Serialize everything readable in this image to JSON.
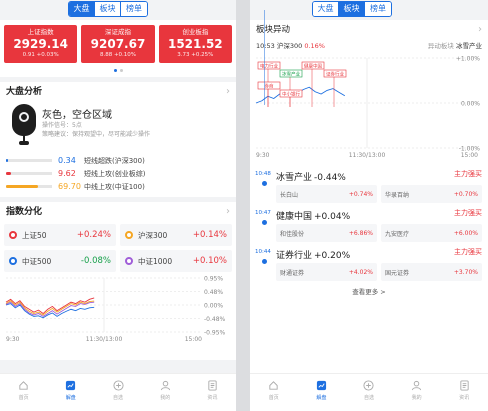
{
  "left": {
    "segment": {
      "tabs": [
        "大盘",
        "板块",
        "榜单"
      ],
      "active": 0
    },
    "indices": [
      {
        "name": "上证指数",
        "value": "2929.14",
        "change": "0.91 +0.03%"
      },
      {
        "name": "深证成指",
        "value": "9207.67",
        "change": "8.88 +0.10%"
      },
      {
        "name": "创业板指",
        "value": "1521.52",
        "change": "3.73 +0.25%"
      }
    ],
    "analysis": {
      "title": "大盘分析",
      "status": "灰色，空仓区域",
      "signal": "操作信号：5点",
      "advice": "策略建议：保持观望中，尽可能减少操作",
      "lines": [
        {
          "value": "0.34",
          "label": "短线超跌(沪深300)",
          "fill": 0.05,
          "color": "#1d6fe0"
        },
        {
          "value": "9.62",
          "label": "短线上攻(创业板综)",
          "fill": 0.1,
          "color": "#e8363d"
        },
        {
          "value": "69.70",
          "label": "中线上攻(中证100)",
          "fill": 0.7,
          "color": "#f5a623"
        }
      ]
    },
    "differentiation": {
      "title": "指数分化",
      "items": [
        {
          "name": "上证50",
          "pct": "+0.24%",
          "color": "#e8363d",
          "dir": "up"
        },
        {
          "name": "沪深300",
          "pct": "+0.14%",
          "color": "#f5a623",
          "dir": "up"
        },
        {
          "name": "中证500",
          "pct": "-0.08%",
          "color": "#1d6fe0",
          "dir": "down"
        },
        {
          "name": "中证1000",
          "pct": "+0.10%",
          "color": "#a05ed8",
          "dir": "up"
        }
      ]
    },
    "chart_data": {
      "type": "line",
      "x_ticks": [
        "9:30",
        "11:30/13:00",
        "15:00"
      ],
      "y_ticks": [
        "0.95%",
        "0.48%",
        "0.00%",
        "-0.48%",
        "-0.95%"
      ],
      "ylim": [
        -0.95,
        0.95
      ],
      "series": [
        {
          "color": "#e8363d",
          "values": [
            0.1,
            0.2,
            0.05,
            0.15,
            -0.05,
            -0.15,
            -0.25,
            -0.18,
            -0.3,
            -0.15,
            -0.05,
            -0.2,
            -0.1,
            0.0,
            0.1,
            0.05,
            0.15,
            0.1,
            0.2,
            0.25
          ]
        },
        {
          "color": "#f5a623",
          "values": [
            0.05,
            0.15,
            0.0,
            0.1,
            -0.1,
            -0.22,
            -0.3,
            -0.25,
            -0.35,
            -0.22,
            -0.12,
            -0.25,
            -0.15,
            -0.05,
            0.05,
            0.0,
            0.1,
            0.05,
            0.12,
            0.14
          ]
        },
        {
          "color": "#1d6fe0",
          "values": [
            0.0,
            0.05,
            -0.1,
            0.0,
            -0.2,
            -0.32,
            -0.4,
            -0.38,
            -0.45,
            -0.35,
            -0.28,
            -0.4,
            -0.3,
            -0.22,
            -0.15,
            -0.2,
            -0.12,
            -0.15,
            -0.1,
            -0.08
          ]
        },
        {
          "color": "#a05ed8",
          "values": [
            0.02,
            0.1,
            -0.05,
            0.05,
            -0.15,
            -0.28,
            -0.35,
            -0.3,
            -0.4,
            -0.3,
            -0.2,
            -0.32,
            -0.22,
            -0.12,
            -0.02,
            -0.05,
            0.05,
            0.02,
            0.08,
            0.1
          ]
        }
      ]
    },
    "nav": [
      {
        "label": "首页",
        "icon": "home-icon"
      },
      {
        "label": "解盘",
        "icon": "chart-icon"
      },
      {
        "label": "自选",
        "icon": "plus-circle-icon"
      },
      {
        "label": "我的",
        "icon": "user-icon"
      },
      {
        "label": "资讯",
        "icon": "doc-icon"
      }
    ],
    "nav_active": 1
  },
  "right": {
    "segment": {
      "tabs": [
        "大盘",
        "板块",
        "榜单"
      ],
      "active": 1
    },
    "title": "板块异动",
    "chart_header": {
      "time": "10:53",
      "index": "沪深300",
      "pct": "0.16%",
      "right1": "异动板块",
      "right2": "冰雪产业"
    },
    "chart_data": {
      "type": "line",
      "x_ticks": [
        "9:30",
        "11:30/13:00",
        "15:00"
      ],
      "y_ticks": [
        "+1.00%",
        "0.00%",
        "-1.00%"
      ],
      "ylim": [
        -1.0,
        1.0
      ],
      "series": [
        {
          "color": "#1d6fe0",
          "values": [
            0.0,
            0.05,
            0.15,
            0.1,
            0.2,
            0.25,
            0.18,
            0.22,
            0.3,
            0.35,
            0.25,
            0.2,
            0.28,
            0.32,
            0.24,
            0.16
          ]
        }
      ],
      "event_labels": [
        "电力行业",
        "冰雪产业",
        "健康中国",
        "证券行业",
        "券商",
        "中小银行"
      ]
    },
    "events": [
      {
        "time": "10:48",
        "sector": "冰雪产业",
        "pct": "-0.44%",
        "dir": "down",
        "tag": "主力强买",
        "stocks": [
          {
            "name": "长白山",
            "pct": "+0.74%"
          },
          {
            "name": "华录百纳",
            "pct": "+0.70%"
          }
        ]
      },
      {
        "time": "10:47",
        "sector": "健康中国",
        "pct": "+0.04%",
        "dir": "up",
        "tag": "主力强买",
        "stocks": [
          {
            "name": "和佳股份",
            "pct": "+6.86%"
          },
          {
            "name": "九安医疗",
            "pct": "+6.00%"
          }
        ]
      },
      {
        "time": "10:44",
        "sector": "证券行业",
        "pct": "+0.20%",
        "dir": "up",
        "tag": "主力强买",
        "stocks": [
          {
            "name": "财通证券",
            "pct": "+4.02%"
          },
          {
            "name": "国元证券",
            "pct": "+3.70%"
          }
        ]
      }
    ],
    "see_more": "查看更多 >",
    "nav": [
      {
        "label": "首页",
        "icon": "home-icon"
      },
      {
        "label": "解盘",
        "icon": "chart-icon"
      },
      {
        "label": "自选",
        "icon": "plus-circle-icon"
      },
      {
        "label": "我的",
        "icon": "user-icon"
      },
      {
        "label": "资讯",
        "icon": "doc-icon"
      }
    ],
    "nav_active": 1
  }
}
